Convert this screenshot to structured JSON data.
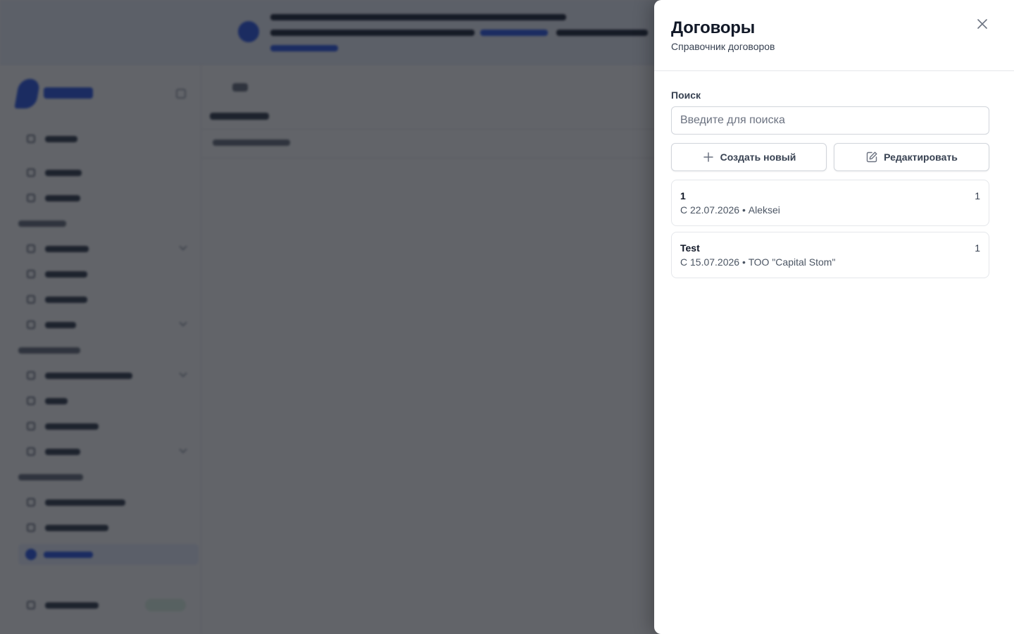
{
  "drawer": {
    "title": "Договоры",
    "subtitle": "Справочник договоров",
    "close_icon": "close-icon"
  },
  "search": {
    "label": "Поиск",
    "placeholder": "Введите для поиска",
    "value": ""
  },
  "actions": {
    "create_label": "Создать новый",
    "create_icon": "plus-icon",
    "edit_label": "Редактировать",
    "edit_icon": "edit-icon"
  },
  "contracts": [
    {
      "title": "1",
      "count": "1",
      "meta": "С 22.07.2026 • Aleksei"
    },
    {
      "title": "Test",
      "count": "1",
      "meta": "С 15.07.2026 • ТОО \"Capital Stom\""
    }
  ],
  "colors": {
    "overlay": "#11141b",
    "accent": "#2f5be8",
    "border": "#d1d5db"
  }
}
